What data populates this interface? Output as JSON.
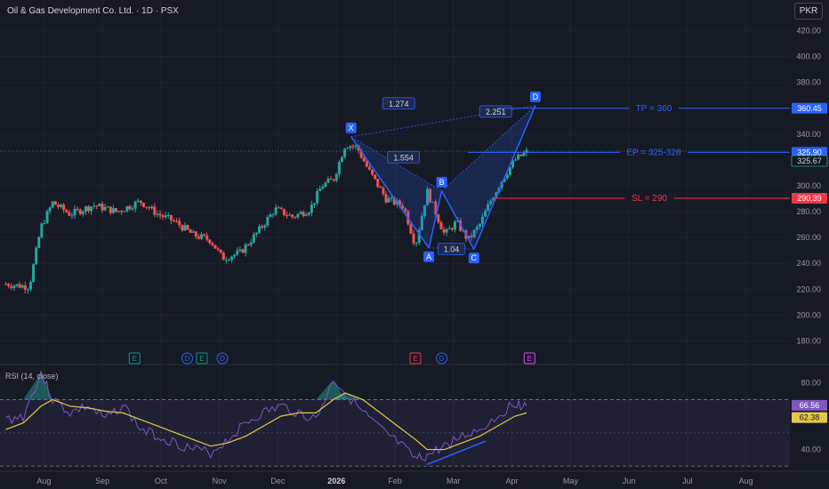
{
  "header": {
    "title": "Oil & Gas Development Co. Ltd. · 1D · PSX",
    "currency_button": "PKR"
  },
  "rsi_panel": {
    "label": "RSI (14, close)"
  },
  "colors": {
    "background": "#161a25",
    "up_candle": "#26a69a",
    "down_candle": "#ef5350",
    "pattern_blue": "#2962ff",
    "pattern_fill": "#2962ff",
    "stop_loss_red": "#f23645",
    "rsi_line": "#7e57c2",
    "rsi_ma": "#e5c845",
    "earnings_green": "#089981",
    "dividend_blue": "#2962ff",
    "earnings_red": "#f23645",
    "split_magenta": "#e040fb"
  },
  "chart_data": {
    "type": "candlestick",
    "title": "Oil & Gas Development Co. Ltd. · 1D · PSX",
    "price_axis": {
      "ticks": [
        420,
        400,
        380,
        340,
        300,
        280,
        260,
        240,
        220,
        200,
        180
      ],
      "tick_labels": [
        "420.00",
        "400.00",
        "380.00",
        "340.00",
        "300.00",
        "280.00",
        "260.00",
        "240.00",
        "220.00",
        "200.00",
        "180.00"
      ],
      "range": [
        170,
        430
      ]
    },
    "time_axis": {
      "labels": [
        "Aug",
        "Sep",
        "Oct",
        "Nov",
        "Dec",
        "2026",
        "Feb",
        "Mar",
        "Apr",
        "May",
        "Jun",
        "Jul",
        "Aug"
      ],
      "months_from_start": [
        0.75,
        1.75,
        2.75,
        3.75,
        4.75,
        5.75,
        6.75,
        7.75,
        8.75,
        9.75,
        10.75,
        11.75,
        12.75
      ],
      "range_months": [
        0,
        13.5
      ]
    },
    "price_series_monthly_approx": {
      "months_from_start": [
        0.1,
        0.5,
        0.7,
        0.9,
        1.2,
        1.6,
        2.0,
        2.4,
        2.7,
        3.0,
        3.3,
        3.6,
        3.8,
        4.1,
        4.4,
        4.7,
        5.0,
        5.3,
        5.5,
        5.7,
        5.9,
        6.1,
        6.3,
        6.6,
        6.9,
        7.1,
        7.3,
        7.6,
        7.8,
        8.0,
        8.2,
        8.4,
        8.6,
        8.8,
        9.0
      ],
      "close": [
        224,
        222,
        268,
        287,
        278,
        285,
        280,
        288,
        278,
        272,
        262,
        258,
        244,
        248,
        264,
        282,
        276,
        282,
        300,
        305,
        332,
        330,
        312,
        290,
        284,
        254,
        296,
        262,
        272,
        258,
        270,
        290,
        306,
        320,
        326
      ]
    },
    "harmonic_pattern": {
      "points": [
        {
          "label": "X",
          "month": 6.0,
          "price": 338
        },
        {
          "label": "A",
          "month": 7.33,
          "price": 252
        },
        {
          "label": "B",
          "month": 7.55,
          "price": 296
        },
        {
          "label": "C",
          "month": 8.1,
          "price": 251
        },
        {
          "label": "D",
          "month": 9.15,
          "price": 362
        }
      ],
      "ratios": [
        "1.274",
        "1.554",
        "1.04",
        "2.251"
      ]
    },
    "levels": [
      {
        "name": "TP = 360",
        "price": 360,
        "badge": "360.45"
      },
      {
        "name": "EP = 325-328",
        "price": 325.9,
        "badge": "325.90"
      },
      {
        "name": "SL = 290",
        "price": 290.39,
        "badge": "290.39"
      }
    ],
    "current_price_badge": "325.67",
    "event_markers": [
      {
        "glyph": "E",
        "kind": "earnings",
        "month": 2.3
      },
      {
        "glyph": "D",
        "kind": "dividend",
        "month": 3.2
      },
      {
        "glyph": "E",
        "kind": "earnings",
        "month": 3.45
      },
      {
        "glyph": "D",
        "kind": "dividend",
        "month": 3.8
      },
      {
        "glyph": "E",
        "kind": "earnings-miss",
        "month": 7.1
      },
      {
        "glyph": "D",
        "kind": "dividend",
        "month": 7.55
      },
      {
        "glyph": "E",
        "kind": "split",
        "month": 9.05
      }
    ],
    "rsi": {
      "period": 14,
      "axis_ticks": [
        80,
        40
      ],
      "tick_labels": [
        "80.00",
        "40.00"
      ],
      "range": [
        28,
        90
      ],
      "upper_band": 70,
      "lower_band": 30,
      "rsi_value": "66.56",
      "ma_value": "62.38",
      "months_from_start": [
        0.1,
        0.4,
        0.7,
        0.9,
        1.2,
        1.5,
        1.8,
        2.1,
        2.4,
        2.7,
        3.0,
        3.3,
        3.6,
        3.9,
        4.2,
        4.5,
        4.8,
        5.1,
        5.4,
        5.7,
        5.9,
        6.2,
        6.5,
        6.8,
        7.1,
        7.3,
        7.6,
        7.9,
        8.2,
        8.5,
        8.8,
        9.0
      ],
      "rsi_values": [
        58,
        60,
        86,
        70,
        62,
        66,
        58,
        67,
        52,
        48,
        44,
        40,
        38,
        46,
        56,
        62,
        66,
        62,
        58,
        82,
        74,
        62,
        52,
        44,
        34,
        36,
        42,
        48,
        52,
        60,
        68,
        66
      ],
      "ma_values": [
        52,
        56,
        66,
        70,
        66,
        65,
        63,
        62,
        58,
        54,
        50,
        46,
        42,
        44,
        48,
        54,
        60,
        62,
        62,
        70,
        74,
        70,
        62,
        54,
        46,
        40,
        40,
        44,
        48,
        54,
        60,
        62
      ]
    }
  }
}
